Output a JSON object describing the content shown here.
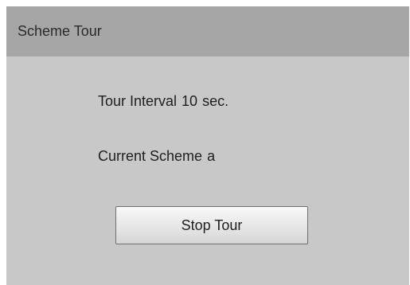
{
  "dialog": {
    "title": "Scheme Tour"
  },
  "tour": {
    "interval_label": "Tour Interval",
    "interval_value": "10",
    "interval_unit": "sec.",
    "scheme_label": "Current Scheme",
    "scheme_value": "a"
  },
  "actions": {
    "stop_label": "Stop Tour"
  },
  "colors": {
    "header_background": "#a6a6a6",
    "body_background": "#c8c8c8"
  }
}
